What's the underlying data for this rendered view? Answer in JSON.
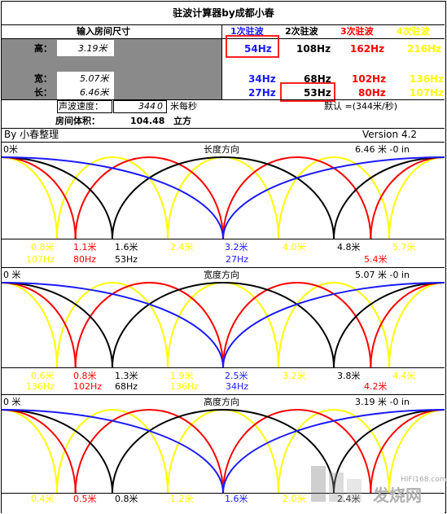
{
  "title": "驻波计算器by成都小春",
  "header": {
    "input_label": "输入房间尺寸",
    "col1": "1次驻波",
    "col2": "2次驻波",
    "col3": "3次驻波",
    "col4": "4次驻波"
  },
  "rows": [
    {
      "label": "高：",
      "value": "3.19米",
      "f1": "54Hz",
      "f2": "108Hz",
      "f3": "162Hz",
      "f4": "216Hz"
    },
    {
      "label": "宽：",
      "value": "5.07米",
      "f1": "34Hz",
      "f2": "68Hz",
      "f3": "102Hz",
      "f4": "136Hz"
    },
    {
      "label": "长：",
      "value": "6.46米",
      "f1": "27Hz",
      "f2": "53Hz",
      "f3": "80Hz",
      "f4": "107Hz"
    }
  ],
  "speed": {
    "label": "声波速度：",
    "value": "344",
    "suffix": "0",
    "unit": "米每秒",
    "default": "默认 =(344米/秒)"
  },
  "volume": {
    "label": "房间体积：",
    "value": "104.48",
    "unit": "立方"
  },
  "credits": {
    "author": "By 小春整理",
    "version": "Version 4.2"
  },
  "panels": [
    {
      "title": "长度方向",
      "left": "0米",
      "right": "6.46 米 -0 in",
      "points": [
        "0.8米",
        "1.1米",
        "1.6米",
        "2.4米",
        "3.2米",
        "4.0米",
        "4.8米",
        "5.7米"
      ],
      "freqs": [
        "107Hz",
        "80Hz",
        "53Hz",
        "27Hz",
        "5.4米"
      ]
    },
    {
      "title": "宽度方向",
      "left": "0 米",
      "right": "5.07 米 -0 in",
      "points": [
        "0.6米",
        "0.8米",
        "1.3米",
        "1.9米",
        "2.5米",
        "3.2米",
        "3.8米",
        "4.4米"
      ],
      "freqs": [
        "136Hz",
        "102Hz",
        "68Hz",
        "136Hz",
        "34Hz",
        "4.2米"
      ]
    },
    {
      "title": "高度方向",
      "left": "0 米",
      "right": "3.19 米 -0 in",
      "points": [
        "0.4米",
        "0.5米",
        "0.8米",
        "1.2米",
        "1.6米",
        "2.0米",
        "2.4米"
      ],
      "freqs": []
    }
  ],
  "watermark": {
    "site": "HIFI168.com",
    "text": "发烧网"
  },
  "colors": {
    "mode1": "#1a1aff",
    "mode2": "#000000",
    "mode3": "#ff0000",
    "mode4": "#ffff00"
  }
}
